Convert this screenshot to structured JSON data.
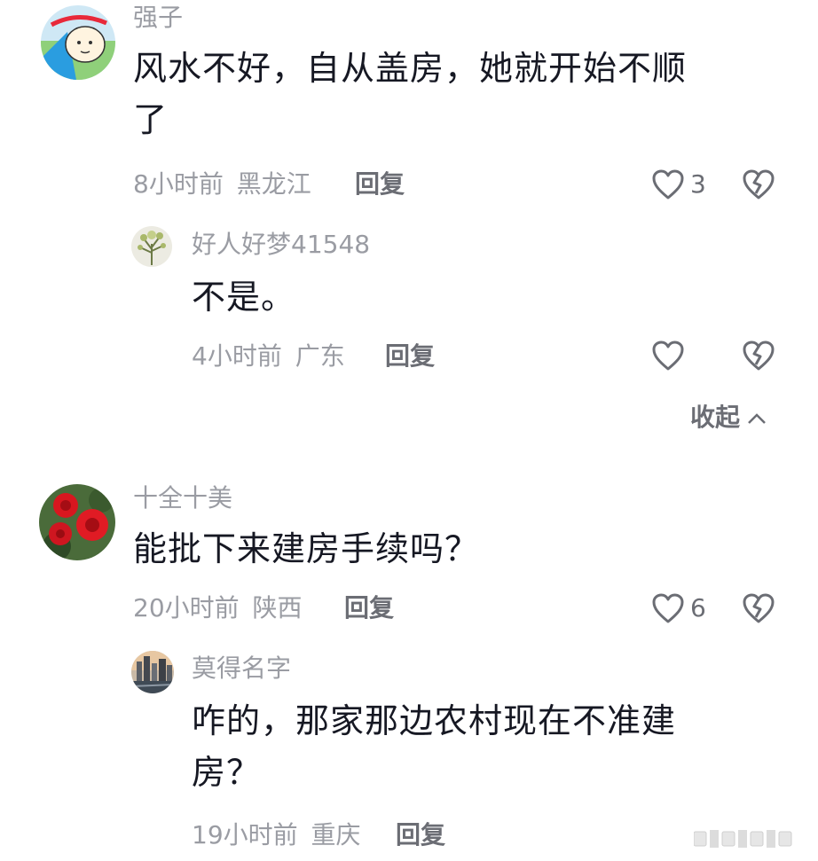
{
  "comments": [
    {
      "username": "强子",
      "content_line1": "风水不好，自从盖房，她就开始不顺",
      "content_line2": "了",
      "time": "8小时前",
      "location": "黑龙江",
      "reply_label": "回复",
      "likes": "3",
      "avatar_icon": "cartoon-avatar-icon",
      "replies": [
        {
          "username": "好人好梦41548",
          "content_line1": "不是。",
          "time": "4小时前",
          "location": "广东",
          "reply_label": "回复",
          "likes": "",
          "avatar_icon": "flower-vase-avatar-icon"
        }
      ],
      "collapse_label": "收起",
      "collapse_icon": "chevron-up-icon"
    },
    {
      "username": "十全十美",
      "content_line1": "能批下来建房手续吗？",
      "time": "20小时前",
      "location": "陕西",
      "reply_label": "回复",
      "likes": "6",
      "avatar_icon": "red-roses-avatar-icon",
      "replies": [
        {
          "username": "莫得名字",
          "content_line1": "咋的，那家那边农村现在不准建",
          "content_line2": "房？",
          "time": "19小时前",
          "location": "重庆",
          "reply_label": "回复",
          "likes": "",
          "avatar_icon": "city-skyline-avatar-icon"
        }
      ]
    }
  ],
  "colors": {
    "text_primary": "#161823",
    "text_secondary": "#9a9ca3",
    "action": "#6b6d74",
    "background": "#ffffff"
  }
}
